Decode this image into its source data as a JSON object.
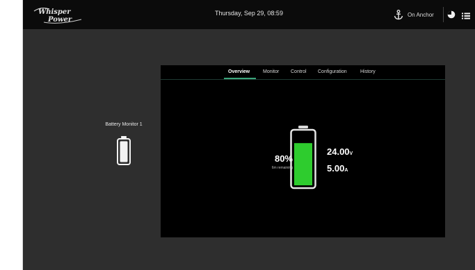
{
  "header": {
    "logo_text_line1": "Whisper",
    "logo_text_line2": "Power",
    "datetime": "Thursday, Sep 29, 08:59",
    "anchor_status": "On Anchor"
  },
  "device": {
    "name": "Battery Monitor 1",
    "charge_level": 1.0
  },
  "tabs": [
    {
      "label": "Overview",
      "active": true
    },
    {
      "label": "Monitor",
      "active": false
    },
    {
      "label": "Control",
      "active": false
    },
    {
      "label": "Configuration",
      "active": false
    },
    {
      "label": "History",
      "active": false
    }
  ],
  "overview": {
    "state_of_charge": "80%",
    "soc_caption": "6m remaining",
    "soc_fraction": 0.8,
    "voltage_value": "24.00",
    "voltage_unit": "V",
    "current_value": "5.00",
    "current_unit": "A"
  },
  "colors": {
    "accent": "#3aa37a",
    "battery_fill": "#2ecc2e",
    "panel_bg": "#000000",
    "app_bg": "#2e2e2e",
    "topbar_bg": "#0b0b0b"
  },
  "icons": {
    "anchor": "anchor-icon",
    "clock": "clock-icon",
    "menu": "menu-icon",
    "battery": "battery-icon"
  }
}
